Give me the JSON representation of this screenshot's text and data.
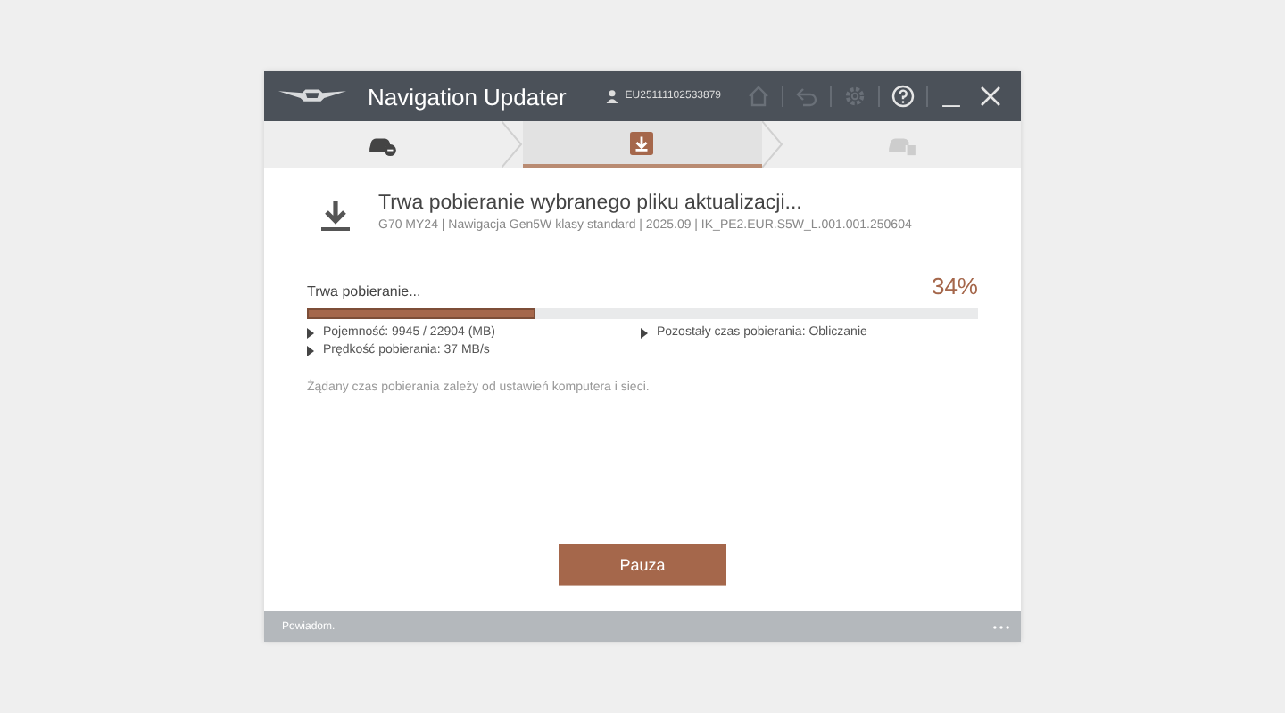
{
  "window": {
    "title": "Navigation Updater",
    "user_id": "EU25111102533879"
  },
  "toolbar": [
    {
      "kind": "home",
      "disabled": true
    },
    {
      "kind": "back",
      "disabled": true
    },
    {
      "kind": "settings",
      "disabled": true
    },
    {
      "kind": "help",
      "disabled": false
    },
    {
      "kind": "minimize",
      "disabled": false
    },
    {
      "kind": "close",
      "disabled": false
    }
  ],
  "steps": [
    {
      "kind": "car-connect",
      "selected": false,
      "disabled": false
    },
    {
      "kind": "download",
      "selected": true,
      "disabled": false
    },
    {
      "kind": "car-files",
      "selected": false,
      "disabled": true
    }
  ],
  "header": {
    "title": "Trwa pobieranie wybranego pliku aktualizacji...",
    "subtitle": "G70 MY24 | Nawigacja Gen5W klasy standard | 2025.09 | IK_PE2.EUR.S5W_L.001.001.250604"
  },
  "progress": {
    "label": "Trwa pobieranie...",
    "percent": "34%",
    "level": 0.34
  },
  "details": [
    "Pojemność: 9945 / 22904 (MB)",
    "Pozostały czas pobierania: Obliczanie",
    "Prędkość pobierania: 37 MB/s"
  ],
  "note": "Żądany czas pobierania zależy od ustawień komputera i sieci.",
  "buttons": [
    "Pauza"
  ],
  "status_bar": {
    "text": "Powiadom."
  }
}
